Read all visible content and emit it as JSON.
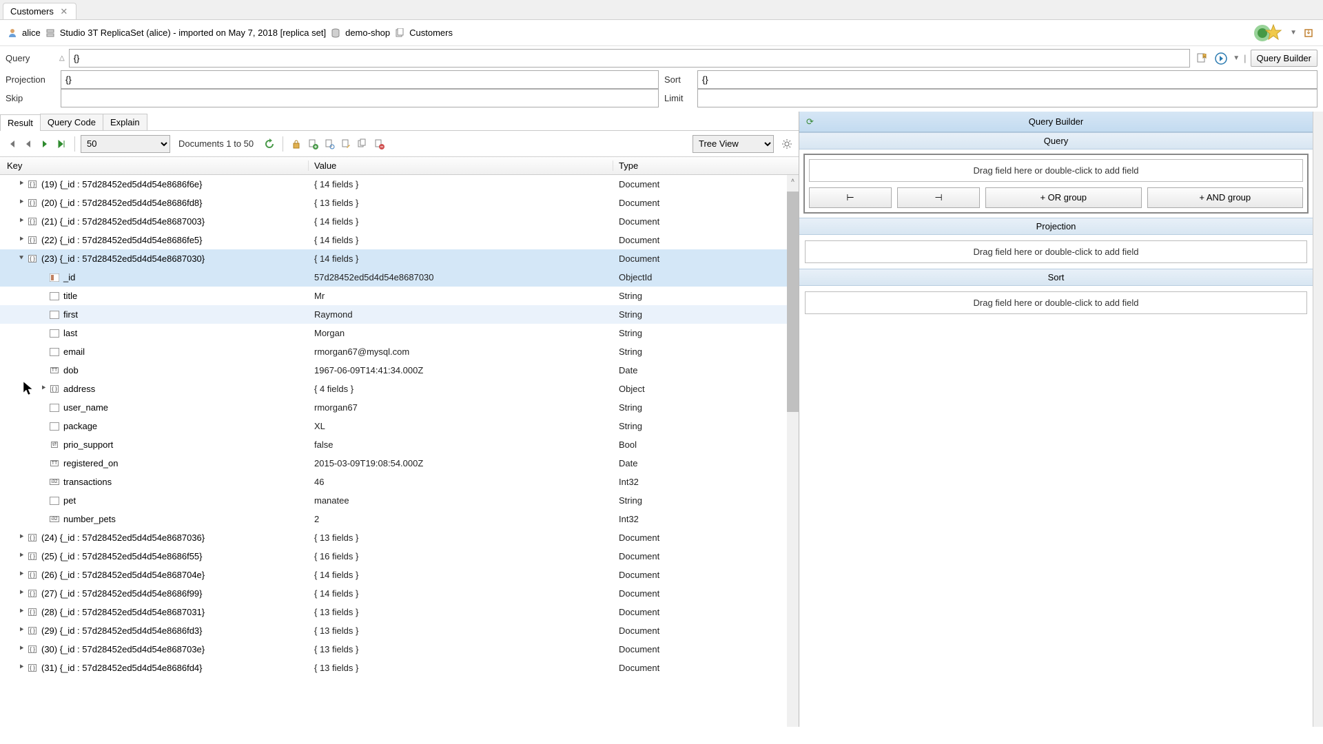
{
  "tab": {
    "title": "Customers"
  },
  "breadcrumb": {
    "user": "alice",
    "conn": "Studio 3T ReplicaSet (alice) - imported on May 7, 2018 [replica set]",
    "db": "demo-shop",
    "coll": "Customers"
  },
  "query": {
    "label": "Query",
    "value": "{}",
    "projection_label": "Projection",
    "projection_value": "{}",
    "sort_label": "Sort",
    "sort_value": "{}",
    "skip_label": "Skip",
    "skip_value": "",
    "limit_label": "Limit",
    "limit_value": "",
    "builder_btn": "Query Builder"
  },
  "subtabs": {
    "result": "Result",
    "code": "Query Code",
    "explain": "Explain"
  },
  "toolbar": {
    "page_size": "50",
    "doc_range": "Documents 1 to 50",
    "view": "Tree View"
  },
  "columns": {
    "key": "Key",
    "value": "Value",
    "type": "Type"
  },
  "rows": [
    {
      "lvl": 1,
      "exp": "closed",
      "icon": "obj",
      "key": "(19) {_id : 57d28452ed5d4d54e8686f6e}",
      "val": "{ 14 fields }",
      "type": "Document"
    },
    {
      "lvl": 1,
      "exp": "closed",
      "icon": "obj",
      "key": "(20) {_id : 57d28452ed5d4d54e8686fd8}",
      "val": "{ 13 fields }",
      "type": "Document"
    },
    {
      "lvl": 1,
      "exp": "closed",
      "icon": "obj",
      "key": "(21) {_id : 57d28452ed5d4d54e8687003}",
      "val": "{ 14 fields }",
      "type": "Document"
    },
    {
      "lvl": 1,
      "exp": "closed",
      "icon": "obj",
      "key": "(22) {_id : 57d28452ed5d4d54e8686fe5}",
      "val": "{ 14 fields }",
      "type": "Document"
    },
    {
      "lvl": 1,
      "exp": "open",
      "icon": "obj",
      "key": "(23) {_id : 57d28452ed5d4d54e8687030}",
      "val": "{ 14 fields }",
      "type": "Document",
      "sel": true
    },
    {
      "lvl": 2,
      "icon": "id",
      "key": "_id",
      "val": "57d28452ed5d4d54e8687030",
      "type": "ObjectId",
      "sel": true
    },
    {
      "lvl": 2,
      "icon": "str",
      "key": "title",
      "val": "Mr",
      "type": "String"
    },
    {
      "lvl": 2,
      "icon": "str",
      "key": "first",
      "val": "Raymond",
      "type": "String",
      "hov": true
    },
    {
      "lvl": 2,
      "icon": "str",
      "key": "last",
      "val": "Morgan",
      "type": "String"
    },
    {
      "lvl": 2,
      "icon": "str",
      "key": "email",
      "val": "rmorgan67@mysql.com",
      "type": "String"
    },
    {
      "lvl": 2,
      "icon": "date",
      "key": "dob",
      "val": "1967-06-09T14:41:34.000Z",
      "type": "Date"
    },
    {
      "lvl": 2,
      "exp": "closed",
      "icon": "obj",
      "key": "address",
      "val": "{ 4 fields }",
      "type": "Object"
    },
    {
      "lvl": 2,
      "icon": "str",
      "key": "user_name",
      "val": "rmorgan67",
      "type": "String"
    },
    {
      "lvl": 2,
      "icon": "str",
      "key": "package",
      "val": "XL",
      "type": "String"
    },
    {
      "lvl": 2,
      "icon": "bool",
      "key": "prio_support",
      "val": "false",
      "type": "Bool"
    },
    {
      "lvl": 2,
      "icon": "date",
      "key": "registered_on",
      "val": "2015-03-09T19:08:54.000Z",
      "type": "Date"
    },
    {
      "lvl": 2,
      "icon": "int",
      "key": "transactions",
      "val": "46",
      "type": "Int32"
    },
    {
      "lvl": 2,
      "icon": "str",
      "key": "pet",
      "val": "manatee",
      "type": "String"
    },
    {
      "lvl": 2,
      "icon": "int",
      "key": "number_pets",
      "val": "2",
      "type": "Int32"
    },
    {
      "lvl": 1,
      "exp": "closed",
      "icon": "obj",
      "key": "(24) {_id : 57d28452ed5d4d54e8687036}",
      "val": "{ 13 fields }",
      "type": "Document"
    },
    {
      "lvl": 1,
      "exp": "closed",
      "icon": "obj",
      "key": "(25) {_id : 57d28452ed5d4d54e8686f55}",
      "val": "{ 16 fields }",
      "type": "Document"
    },
    {
      "lvl": 1,
      "exp": "closed",
      "icon": "obj",
      "key": "(26) {_id : 57d28452ed5d4d54e868704e}",
      "val": "{ 14 fields }",
      "type": "Document"
    },
    {
      "lvl": 1,
      "exp": "closed",
      "icon": "obj",
      "key": "(27) {_id : 57d28452ed5d4d54e8686f99}",
      "val": "{ 14 fields }",
      "type": "Document"
    },
    {
      "lvl": 1,
      "exp": "closed",
      "icon": "obj",
      "key": "(28) {_id : 57d28452ed5d4d54e8687031}",
      "val": "{ 13 fields }",
      "type": "Document"
    },
    {
      "lvl": 1,
      "exp": "closed",
      "icon": "obj",
      "key": "(29) {_id : 57d28452ed5d4d54e8686fd3}",
      "val": "{ 13 fields }",
      "type": "Document"
    },
    {
      "lvl": 1,
      "exp": "closed",
      "icon": "obj",
      "key": "(30) {_id : 57d28452ed5d4d54e868703e}",
      "val": "{ 13 fields }",
      "type": "Document"
    },
    {
      "lvl": 1,
      "exp": "closed",
      "icon": "obj",
      "key": "(31) {_id : 57d28452ed5d4d54e8686fd4}",
      "val": "{ 13 fields }",
      "type": "Document"
    }
  ],
  "qb": {
    "title": "Query Builder",
    "query_section": "Query",
    "drop_hint": "Drag field here or double-click to add field",
    "remove_btn": "⊢",
    "remove_all_btn": "⊣",
    "or_btn": "+ OR group",
    "and_btn": "+ AND group",
    "projection_section": "Projection",
    "sort_section": "Sort"
  }
}
